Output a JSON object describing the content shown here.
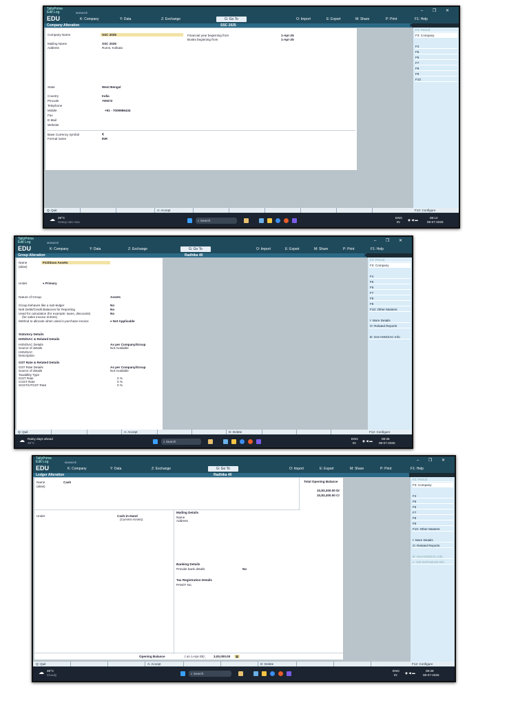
{
  "app": {
    "brand": "TallyPrime",
    "edition": "EDU",
    "edit_log": "Edit Log",
    "manage": "MANAGE"
  },
  "menu": {
    "company": "K: Company",
    "data": "Y: Data",
    "exchange": "Z: Exchange",
    "goto": "G: Go To",
    "import": "O: Import",
    "export": "E: Export",
    "share": "M: Share",
    "print": "P: Print",
    "help": "F1: Help"
  },
  "window_controls": "– ❐ ✕",
  "screen1": {
    "title_left": "Company Alteration",
    "title_center": "SSC 2025",
    "close": "✕",
    "fields": {
      "company_name_label": "Company Name",
      "company_name": "SSC 2025",
      "mailing_name_label": "Mailing Name",
      "mailing_name": "SSC 2025",
      "address_label": "Address",
      "address": "Rums, Kolkata",
      "state_label": "State",
      "state": "West Bengal",
      "country_label": "Country",
      "country": "India",
      "pincode_label": "Pincode",
      "pincode": "700072",
      "telephone_label": "Telephone",
      "mobile_label": "Mobile",
      "mobile": "+91  -  7009986434",
      "fax_label": "Fax",
      "email_label": "E-Mail",
      "website_label": "Website",
      "currency_symbol_label": "Base Currency symbol",
      "currency_symbol": "₹",
      "formal_name_label": "Formal name",
      "formal_name": "INR",
      "fy_label": "Financial year beginning from",
      "fy": "1-Apr-25",
      "books_label": "Books beginning from",
      "books": "1-Apr-25"
    },
    "side": [
      "F2: Period",
      "F3: Company",
      "",
      "F4",
      "F5",
      "F6",
      "F7",
      "F8",
      "F9",
      "F10"
    ],
    "bottom": {
      "quit": "Q: Quit",
      "accept": "A: Accept",
      "configure": "F12: Configure"
    },
    "taskbar": {
      "temp": "29°C",
      "weather": "Heavy rain now",
      "search": "Search",
      "lang": "ENG",
      "region": "IN",
      "time": "08:12",
      "date": "08-07-2025"
    }
  },
  "screen2": {
    "title_left": "Group Alteration",
    "title_center": "Radhika 40",
    "close": "✕",
    "fields": {
      "name_label": "Name",
      "name": "Fictitious Assets",
      "alias_label": "(alias)",
      "under_label": "Under",
      "under": "♦ Primary",
      "nature_label": "Nature of Group",
      "nature": "Assets",
      "subledger_label": "Group behaves like a sub-ledger",
      "subledger": "No",
      "net_label": "Nett Debit/Credit Balances for Reporting",
      "net": "No",
      "calc_label": "Used for calculation (for example: taxes, discounts)",
      "calc": "No",
      "calc_sub": "(for sales invoice entries)",
      "method_label": "Method to allocate when used in purchase invoice",
      "method": "♦ Not Applicable",
      "statutory": "Statutory Details",
      "hsn_head": "HSN/SAC & Related Details",
      "hsn_label": "HSN/SAC Details",
      "hsn": "As per Company/Group",
      "src_label": "Source of details",
      "src": "Not Available",
      "hsnsac_label": "HSN/SAC",
      "desc_label": "Description",
      "gst_head": "GST Rate & Related Details",
      "gst_label": "GST Rate Details",
      "gst": "As per Company/Group",
      "gsrc_label": "Source of details",
      "gsrc": "Not Available",
      "taxability_label": "Taxability Type",
      "igst_label": "IGST Rate",
      "igst": "0  %",
      "cgst_label": "CGST Rate",
      "cgst": "0  %",
      "sgst_label": "SGST/UTGST Rate",
      "sgst": "0  %"
    },
    "side": [
      "F2: Period",
      "F3: Company",
      "",
      "F4",
      "F5",
      "F6",
      "F7",
      "F8",
      "F9",
      "F10: Other Masters",
      "",
      "I: More Details",
      "O: Related Reports",
      "",
      "B: Get HSN/SAC Info"
    ],
    "bottom": {
      "quit": "Q: Quit",
      "accept": "A: Accept",
      "delete": "D: Delete",
      "configure": "F12: Configure"
    },
    "taskbar": {
      "temp": "28°C",
      "weather": "Rainy days ahead",
      "search": "Search",
      "lang": "ENG",
      "region": "IN",
      "time": "08:36",
      "date": "08-07-2025"
    }
  },
  "screen3": {
    "title_left": "Ledger Alteration",
    "title_center": "Radhika 40",
    "total_label": "Total Opening Balance",
    "total_dr": "10,83,300.00 Dr",
    "total_cr": "10,83,300.00 Cr",
    "fields": {
      "name_label": "Name",
      "name": "Cash",
      "alias_label": "(alias)",
      "under_label": "Under",
      "under": "Cash-in-Hand",
      "under_sub": "(Current Assets)",
      "mailing_head": "Mailing Details",
      "m_name_label": "Name",
      "m_address_label": "Address",
      "banking_head": "Banking Details",
      "bank_label": "Provide bank details",
      "bank": "No",
      "tax_head": "Tax Registration Details",
      "pan_label": "PAN/IT No.",
      "opening_label": "Opening Balance",
      "opening_on": "( on 1-Apr-25)  :",
      "opening": "3,00,000.00"
    },
    "side": [
      "F2: Period",
      "F3: Company",
      "",
      "F4",
      "F5",
      "F6",
      "F7",
      "F8",
      "F9",
      "F10: Other Masters",
      "",
      "I: More Details",
      "O: Related Reports",
      "",
      "B: Get HSN/SAC Info",
      "L: Get GSTIN/UIN Info"
    ],
    "bottom": {
      "quit": "Q: Quit",
      "accept": "A: Accept",
      "delete": "D: Delete",
      "configure": "F12: Configure"
    },
    "taskbar": {
      "temp": "28°C",
      "weather": "Cloudy",
      "search": "Search",
      "lang": "ENG",
      "region": "IN",
      "time": "08:39",
      "date": "08-07-2025"
    }
  },
  "colors": {
    "topbar": "#1f4a5c",
    "title": "#2b6a86",
    "highlight": "#f2e3a6",
    "side": "#d9ecf8",
    "taskbar": "#1b2430"
  }
}
